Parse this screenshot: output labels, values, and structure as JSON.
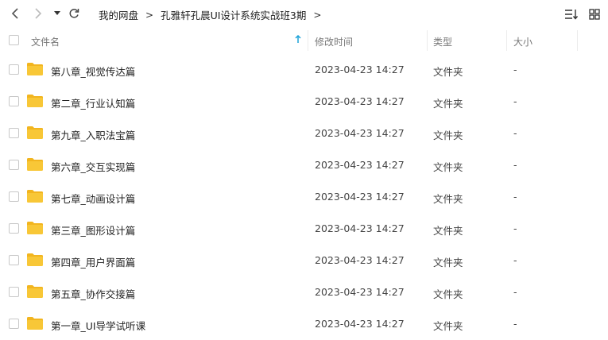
{
  "breadcrumb": {
    "items": [
      "我的网盘",
      "孔雅轩孔晨UI设计系统实战班3期"
    ],
    "separator": ">"
  },
  "columns": {
    "name": "文件名",
    "modified": "修改时间",
    "type": "类型",
    "size": "大小"
  },
  "colors": {
    "folder": "#f8c737",
    "folder_dark": "#f2b51f",
    "accent": "#1fa3d8"
  },
  "files": [
    {
      "name": "第八章_视觉传达篇",
      "modified": "2023-04-23 14:27",
      "type": "文件夹",
      "size": "-"
    },
    {
      "name": "第二章_行业认知篇",
      "modified": "2023-04-23 14:27",
      "type": "文件夹",
      "size": "-"
    },
    {
      "name": "第九章_入职法宝篇",
      "modified": "2023-04-23 14:27",
      "type": "文件夹",
      "size": "-"
    },
    {
      "name": "第六章_交互实现篇",
      "modified": "2023-04-23 14:27",
      "type": "文件夹",
      "size": "-"
    },
    {
      "name": "第七章_动画设计篇",
      "modified": "2023-04-23 14:27",
      "type": "文件夹",
      "size": "-"
    },
    {
      "name": "第三章_图形设计篇",
      "modified": "2023-04-23 14:27",
      "type": "文件夹",
      "size": "-"
    },
    {
      "name": "第四章_用户界面篇",
      "modified": "2023-04-23 14:27",
      "type": "文件夹",
      "size": "-"
    },
    {
      "name": "第五章_协作交接篇",
      "modified": "2023-04-23 14:27",
      "type": "文件夹",
      "size": "-"
    },
    {
      "name": "第一章_UI导学试听课",
      "modified": "2023-04-23 14:27",
      "type": "文件夹",
      "size": "-"
    }
  ]
}
